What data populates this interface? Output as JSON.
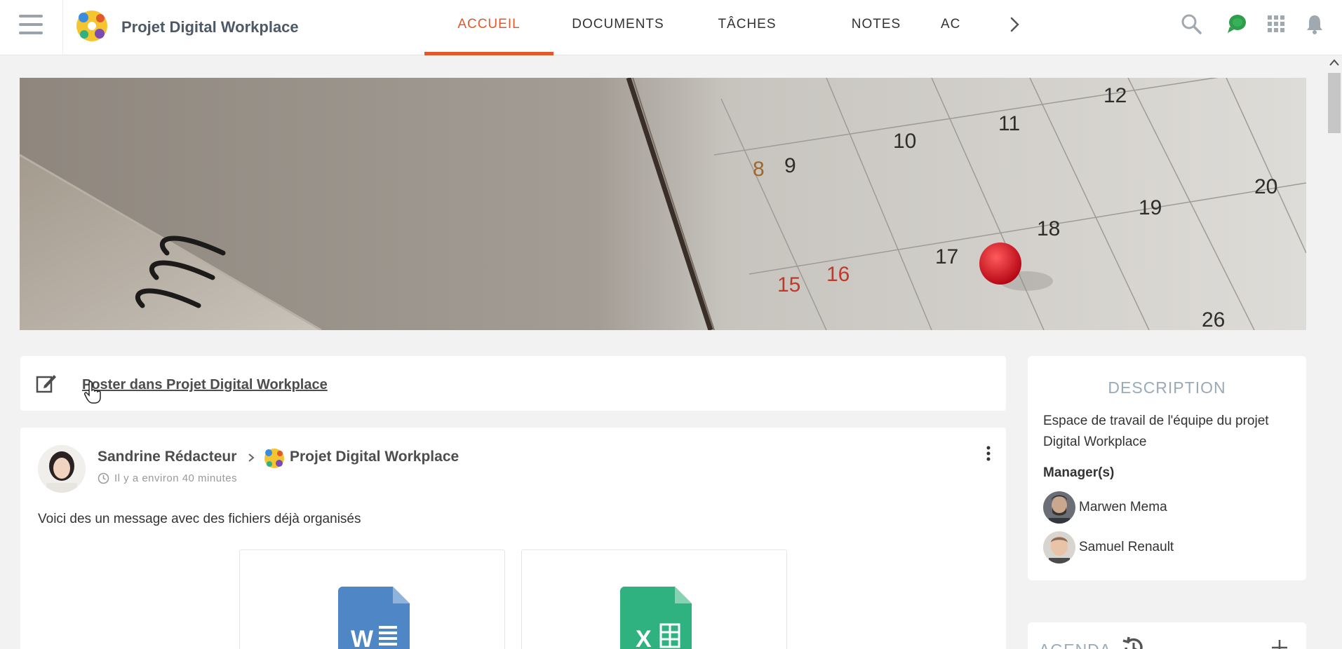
{
  "header": {
    "space_title": "Projet Digital Workplace",
    "tabs": [
      {
        "label": "ACCUEIL",
        "active": true
      },
      {
        "label": "DOCUMENTS",
        "active": false
      },
      {
        "label": "TÂCHES",
        "active": false
      },
      {
        "label": "NOTES",
        "active": false
      },
      {
        "label": "AC",
        "active": false
      }
    ],
    "icons": [
      "menu-icon",
      "search-icon",
      "chat-icon",
      "apps-grid-icon",
      "notification-bell-icon",
      "chevron-right-icon"
    ],
    "accent_color": "#e0592a",
    "chat_color": "#2e9e4a"
  },
  "banner": {
    "calendar_numbers": [
      "8",
      "9",
      "10",
      "11",
      "12",
      "15",
      "16",
      "17",
      "18",
      "19",
      "20",
      "26"
    ]
  },
  "composer": {
    "label": "Poster dans Projet Digital Workplace",
    "icon": "edit-icon"
  },
  "post": {
    "author": "Sandrine Rédacteur",
    "space": "Projet Digital Workplace",
    "time": "Il y a environ 40 minutes",
    "text": "Voici des un message avec des fichiers déjà organisés",
    "attachments": [
      {
        "type": "word",
        "letter": "W",
        "color": "#4f86c6"
      },
      {
        "type": "excel",
        "letter": "X",
        "color": "#2fb280"
      }
    ]
  },
  "description": {
    "title": "DESCRIPTION",
    "text": "Espace de travail de l'équipe du projet Digital Workplace",
    "managers_label": "Manager(s)",
    "managers": [
      "Marwen Mema",
      "Samuel Renault"
    ]
  },
  "agenda": {
    "title": "AGENDA"
  }
}
